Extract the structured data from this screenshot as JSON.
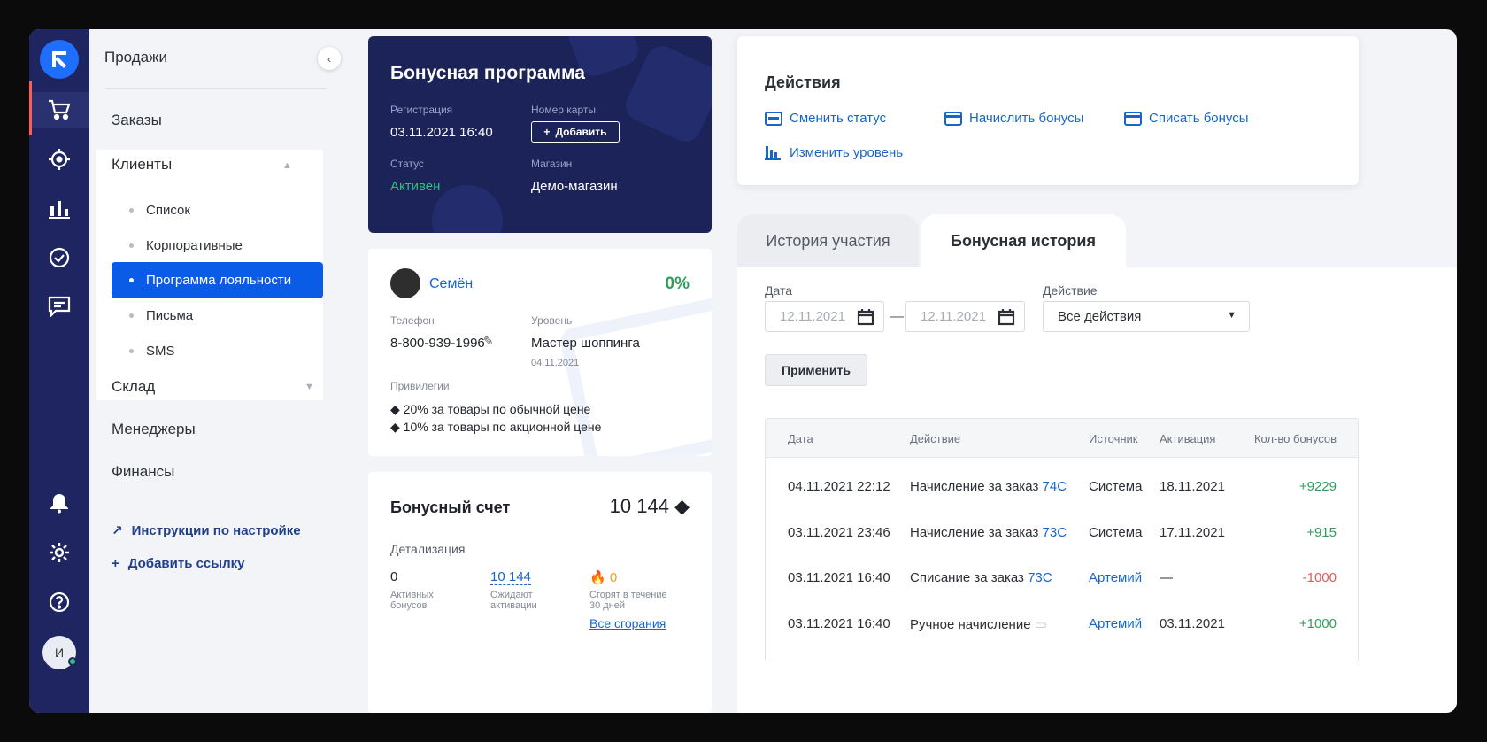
{
  "nav": {
    "section": "Продажи",
    "items": {
      "orders": "Заказы",
      "clients": "Клиенты",
      "warehouse": "Склад",
      "managers": "Менеджеры",
      "finance": "Финансы"
    },
    "clients_sub": [
      "Список",
      "Корпоративные",
      "Программа лояльности",
      "Письма",
      "SMS"
    ],
    "links": {
      "setup": "Инструкции по настройке",
      "add_link": "Добавить ссылку"
    },
    "user_initial": "И"
  },
  "bonus_program": {
    "title": "Бонусная программа",
    "registration_label": "Регистрация",
    "registration_value": "03.11.2021 16:40",
    "card_label": "Номер карты",
    "add_button": "Добавить",
    "status_label": "Статус",
    "status_value": "Активен",
    "shop_label": "Магазин",
    "shop_value": "Демо-магазин"
  },
  "client": {
    "name": "Семён",
    "percent": "0%",
    "phone_label": "Телефон",
    "phone_value": "8-800-939-1996",
    "level_label": "Уровень",
    "level_value": "Мастер шоппинга",
    "level_date": "04.11.2021",
    "privileges_label": "Привилегии",
    "privileges": [
      "20% за товары по обычной цене",
      "10% за товары по акционной цене"
    ]
  },
  "bonus_account": {
    "title": "Бонусный счет",
    "total": "10 144",
    "details_label": "Детализация",
    "active_value": "0",
    "active_label": "Активных бонусов",
    "pending_value": "10 144",
    "pending_label": "Ожидают активации",
    "expire_value": "0",
    "expire_label": "Сгорят в течение 30 дней",
    "all_expire_link": "Все сгорания"
  },
  "actions": {
    "title": "Действия",
    "change_status": "Сменить статус",
    "add_bonus": "Начислить бонусы",
    "write_off": "Списать бонусы",
    "change_level": "Изменить уровень"
  },
  "tabs": {
    "history": "История участия",
    "bonus_history": "Бонусная история"
  },
  "filters": {
    "date_label": "Дата",
    "date_from": "12.11.2021",
    "date_to": "12.11.2021",
    "dash": "—",
    "action_label": "Действие",
    "action_value": "Все действия",
    "apply": "Применить"
  },
  "table": {
    "headers": [
      "Дата",
      "Действие",
      "Источник",
      "Активация",
      "Кол-во бонусов"
    ],
    "rows": [
      {
        "date": "04.11.2021 22:12",
        "action": "Начисление за заказ",
        "order": "74C",
        "source": "Система",
        "activation": "18.11.2021",
        "amount": "+9229"
      },
      {
        "date": "03.11.2021 23:46",
        "action": "Начисление за заказ",
        "order": "73C",
        "source": "Система",
        "activation": "17.11.2021",
        "amount": "+915"
      },
      {
        "date": "03.11.2021 16:40",
        "action": "Списание за заказ",
        "order": "73C",
        "source": "Артемий",
        "activation": "—",
        "amount": "-1000"
      },
      {
        "date": "03.11.2021 16:40",
        "action": "Ручное начисление",
        "order": "",
        "source": "Артемий",
        "activation": "03.11.2021",
        "amount": "+1000"
      }
    ]
  },
  "colors": {
    "rail": "#1e2560",
    "accent": "#0a5be6",
    "link": "#1765c8",
    "positive": "#2f9e5a",
    "negative": "#e05a5a",
    "status_active": "#2ec27e"
  }
}
